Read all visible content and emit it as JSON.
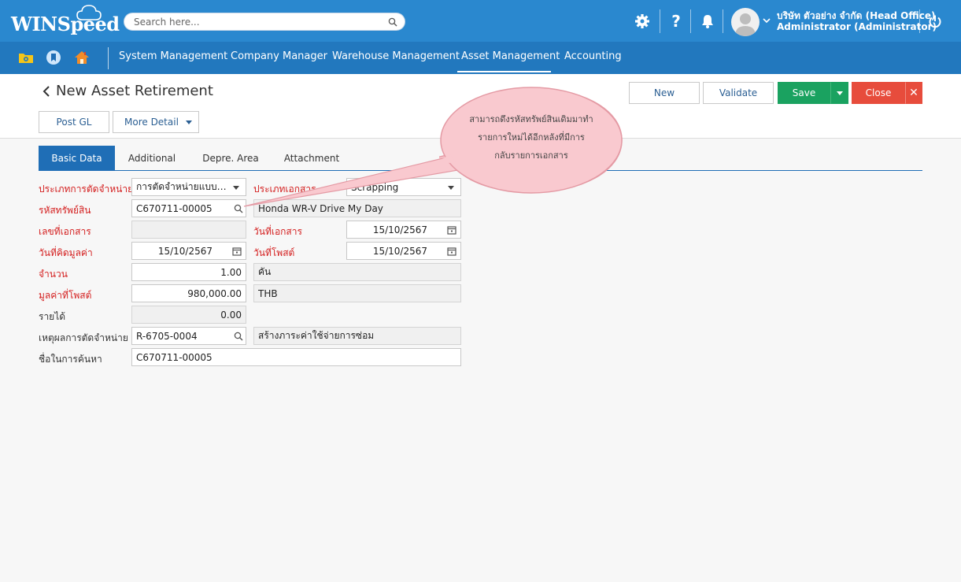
{
  "app": {
    "logo": "WINSpeed"
  },
  "header": {
    "search_placeholder": "Search here...",
    "icons": [
      "gear-icon",
      "help-icon",
      "bell-icon",
      "user-avatar",
      "power-icon"
    ],
    "user_company": "บริษัท ตัวอย่าง จำกัด (Head Office)",
    "user_role": "Administrator (Administrator)"
  },
  "nav": {
    "icons": [
      "folder-icon",
      "bookmark-icon",
      "home-icon"
    ],
    "menu": [
      {
        "label": "System Management"
      },
      {
        "label": "Company Manager"
      },
      {
        "label": "Warehouse Management"
      },
      {
        "label": "Asset Management",
        "active": true
      },
      {
        "label": "Accounting"
      }
    ]
  },
  "page": {
    "title": "New Asset Retirement",
    "buttons": {
      "post_gl": "Post GL",
      "more_detail": "More Detail",
      "new": "New",
      "validate": "Validate",
      "save": "Save",
      "close": "Close"
    },
    "tabs": [
      {
        "label": "Basic Data",
        "active": true
      },
      {
        "label": "Additional"
      },
      {
        "label": "Depre. Area"
      },
      {
        "label": "Attachment"
      }
    ]
  },
  "form": {
    "retire_type": {
      "label": "ประเภทการตัดจำหน่าย",
      "value": "การตัดจำหน่ายแบบตัด..."
    },
    "doc_type": {
      "label": "ประเภทเอกสาร",
      "value": "Scrapping"
    },
    "asset_code": {
      "label": "รหัสทรัพย์สิน",
      "value": "C670711-00005",
      "name": "Honda WR-V Drive My Day"
    },
    "doc_no": {
      "label": "เลขที่เอกสาร",
      "value": ""
    },
    "doc_date": {
      "label": "วันที่เอกสาร",
      "value": "15/10/2567"
    },
    "calc_date": {
      "label": "วันที่คิดมูลค่า",
      "value": "15/10/2567"
    },
    "post_date": {
      "label": "วันที่โพสต์",
      "value": "15/10/2567"
    },
    "qty": {
      "label": "จำนวน",
      "value": "1.00",
      "unit": "คัน"
    },
    "post_value": {
      "label": "มูลค่าที่โพสต์",
      "value": "980,000.00",
      "currency": "THB"
    },
    "income": {
      "label": "รายได้",
      "value": "0.00"
    },
    "reason": {
      "label": "เหตุผลการตัดจำหน่าย",
      "value": "R-6705-0004",
      "desc": "สร้างภาระค่าใช้จ่ายการซ่อม"
    },
    "search_name": {
      "label": "ชื่อในการค้นหา",
      "value": "C670711-00005"
    }
  },
  "callout": {
    "lines": [
      "สามารถดึงรหัสทรัพย์สินเดิมมาทำ",
      "รายการใหม่ได้อีกหลังที่มีการ",
      "กลับรายการเอกสาร"
    ]
  },
  "colors": {
    "header_bg": "#2a88cf",
    "nav_bg": "#2278be",
    "tab_active": "#1f6eb6",
    "save_green": "#1aa260",
    "close_red": "#e74c3c",
    "required_label": "#d42020",
    "callout_fill": "#f9c9cf"
  }
}
